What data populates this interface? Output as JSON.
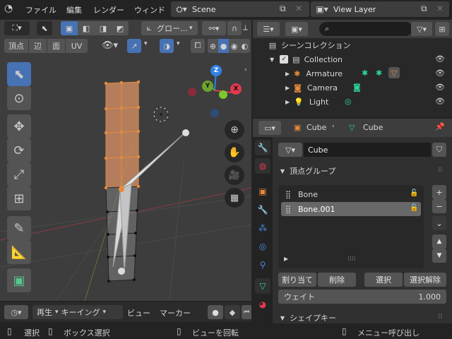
{
  "topbar": {
    "menus": [
      "ファイル",
      "編集",
      "レンダー",
      "ウィンド"
    ],
    "scene": "Scene",
    "view_layer": "View Layer"
  },
  "viewport": {
    "transform_orientation": "グロー…",
    "mode_tabs": [
      "頂点",
      "辺",
      "面",
      "UV"
    ],
    "axes": {
      "z": "Z",
      "y": "Y",
      "x": "X"
    }
  },
  "timeline": {
    "play": "再生",
    "keying": "キーイング",
    "view": "ビュー",
    "marker": "マーカー"
  },
  "status": {
    "select": "選択",
    "box_select": "ボックス選択",
    "rotate_view": "ビューを回転",
    "call_menu": "メニュー呼び出し"
  },
  "outliner": {
    "scene_collection": "シーンコレクション",
    "items": [
      {
        "label": "Collection",
        "depth": 1
      },
      {
        "label": "Armature",
        "depth": 2
      },
      {
        "label": "Camera",
        "depth": 2
      },
      {
        "label": "Light",
        "depth": 2
      }
    ]
  },
  "properties": {
    "breadcrumb_object": "Cube",
    "breadcrumb_data": "Cube",
    "datablock_name": "Cube",
    "vertex_groups_title": "頂点グループ",
    "vertex_groups": [
      "Bone",
      "Bone.001"
    ],
    "selected_group": "Bone.001",
    "assign": "割り当て",
    "remove": "削除",
    "select": "選択",
    "deselect": "選択解除",
    "weight_label": "ウェイト",
    "weight_value": "1.000",
    "shape_keys_title": "シェイプキー"
  },
  "colors": {
    "accent_blue": "#4772b3",
    "selection_orange": "#e88a3c",
    "axis_x": "#e0394f",
    "axis_y": "#6ba52e",
    "axis_z": "#2f83e6",
    "green_icon": "#2dd1a0"
  }
}
